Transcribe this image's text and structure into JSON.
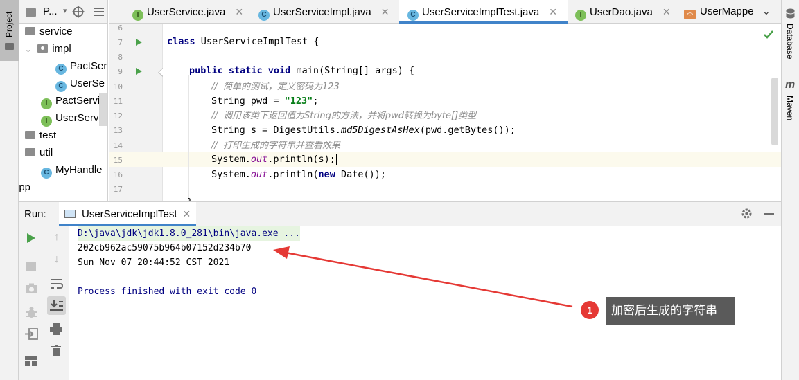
{
  "left_strip": {
    "label": "Project"
  },
  "right_strip": {
    "database_label": "Database",
    "maven_label": "Maven",
    "maven_letter": "m"
  },
  "project": {
    "header": "P...",
    "tree": [
      {
        "label": "service",
        "type": "folder"
      },
      {
        "label": "impl",
        "type": "package"
      },
      {
        "label": "PactSer",
        "type": "class"
      },
      {
        "label": "UserSe",
        "type": "class"
      },
      {
        "label": "PactServic",
        "type": "interface"
      },
      {
        "label": "UserServic",
        "type": "interface"
      },
      {
        "label": "test",
        "type": "folder"
      },
      {
        "label": "util",
        "type": "folder"
      },
      {
        "label": "MyHandle",
        "type": "class"
      },
      {
        "label": "app",
        "type": "text"
      }
    ]
  },
  "tabs": [
    {
      "label": "UserService.java",
      "icon": "I",
      "active": false
    },
    {
      "label": "UserServiceImpl.java",
      "icon": "C",
      "active": false
    },
    {
      "label": "UserServiceImplTest.java",
      "icon": "C",
      "active": true
    },
    {
      "label": "UserDao.java",
      "icon": "I",
      "active": false
    },
    {
      "label": "UserMappe",
      "icon": "xml",
      "active": false
    }
  ],
  "editor": {
    "line_numbers": [
      "6",
      "7",
      "8",
      "9",
      "10",
      "11",
      "12",
      "13",
      "14",
      "15",
      "16",
      "17"
    ],
    "code": {
      "l7_kw": "class",
      "l7_rest": " UserServiceImplTest {",
      "l9_kw": "public static void",
      "l9_rest": " main(String[] args) {",
      "l10": "//  简单的测试，定义密码为123",
      "l11_a": "String pwd = ",
      "l11_str": "\"123\"",
      "l11_b": ";",
      "l12": "//  调用该类下返回值为String的方法，并将pwd转换为byte[]类型",
      "l13_a": "String s = DigestUtils.",
      "l13_it": "md5DigestAsHex",
      "l13_b": "(pwd.getBytes());",
      "l14": "//  打印生成的字符串并查看效果",
      "l15_a": "System.",
      "l15_st": "out",
      "l15_b": ".println(s);",
      "l16_a": "System.",
      "l16_st": "out",
      "l16_b": ".println(",
      "l16_kw": "new",
      "l16_c": " Date());",
      "l18": "}"
    }
  },
  "run": {
    "label": "Run:",
    "tab_label": "UserServiceImplTest",
    "console": [
      "D:\\java\\jdk\\jdk1.8.0_281\\bin\\java.exe ...",
      "202cb962ac59075b964b07152d234b70",
      "Sun Nov 07 20:44:52 CST 2021",
      "",
      "Process finished with exit code 0"
    ]
  },
  "annotation": {
    "number": "1",
    "text": "加密后生成的字符串"
  },
  "colors": {
    "accent": "#4083c9",
    "run_green": "#4aa14a",
    "badge_red": "#e53935",
    "callout_bg": "#5a5a5a"
  }
}
